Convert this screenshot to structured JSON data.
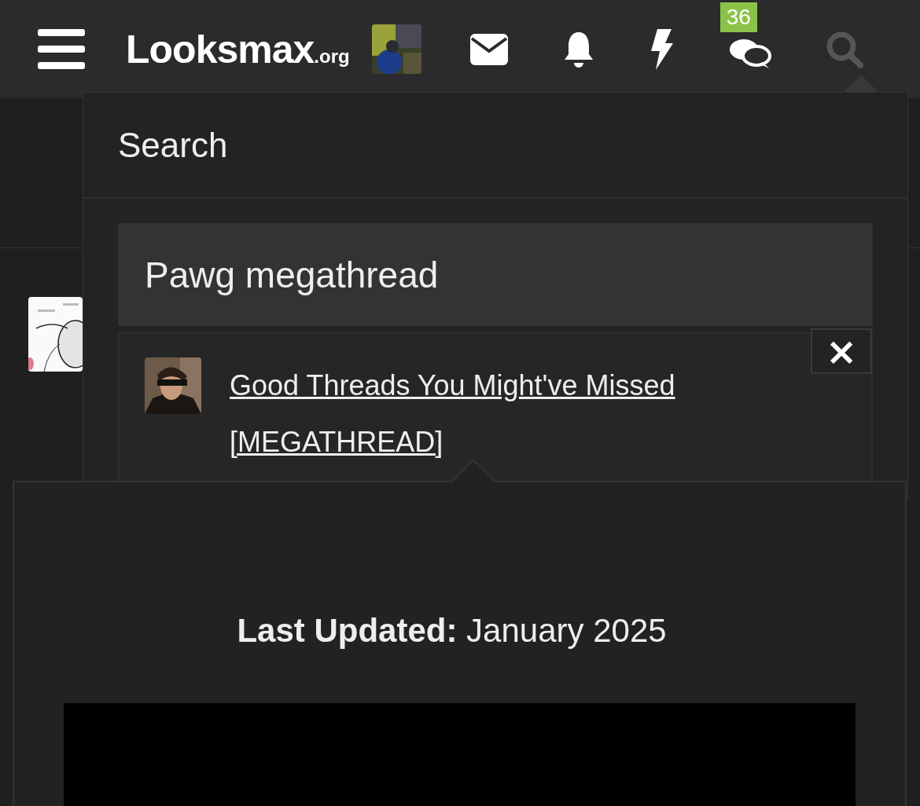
{
  "header": {
    "logo": {
      "name": "Looksmax",
      "suffix": ".org"
    },
    "alerts_badge": "36"
  },
  "search_panel": {
    "title": "Search",
    "query": "Pawg megathread",
    "results": [
      {
        "title": "Good Threads You Might've Missed [MEGATHREAD]"
      }
    ],
    "close_label": "×"
  },
  "popover": {
    "updated": "**Last Updated:** January 2025"
  }
}
